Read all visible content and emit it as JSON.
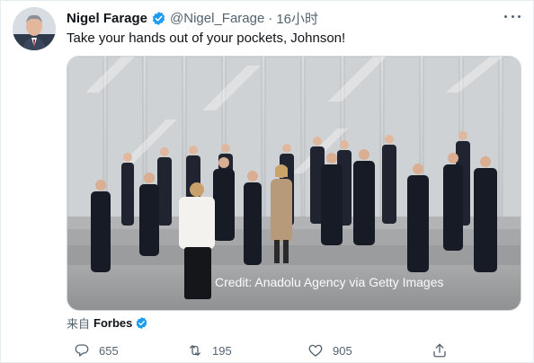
{
  "tweet": {
    "author": {
      "display_name": "Nigel Farage",
      "handle": "@Nigel_Farage",
      "verified": true,
      "avatar": "avatar-photo"
    },
    "separator": "·",
    "time": "16小时",
    "text": "Take your hands out of your pockets, Johnson!",
    "media": {
      "type": "video-still",
      "caption": "Credit: Anadolu Agency via Getty Images"
    },
    "via": {
      "label": "来自",
      "source": "Forbes",
      "source_verified": true
    },
    "actions": {
      "reply": {
        "icon": "reply-icon",
        "count": "655"
      },
      "retweet": {
        "icon": "retweet-icon",
        "count": "195"
      },
      "like": {
        "icon": "heart-icon",
        "count": "905"
      },
      "share": {
        "icon": "share-icon"
      }
    }
  },
  "colors": {
    "text_primary": "#0f1419",
    "text_secondary": "#536471",
    "verified_blue": "#1d9bf0",
    "border": "#cfd9de"
  }
}
